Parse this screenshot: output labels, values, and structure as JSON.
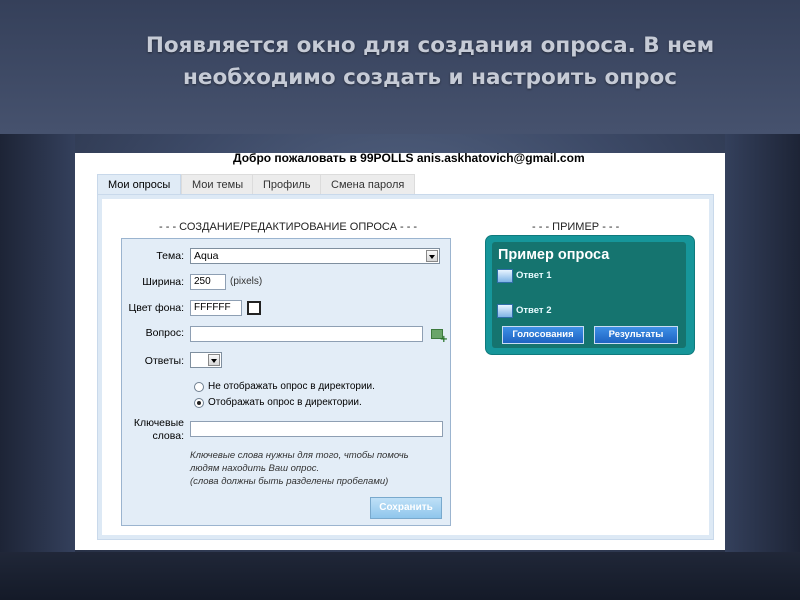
{
  "slide": {
    "title_line1": "Появляется окно для создания опроса. В нем",
    "title_line2": "необходимо создать и настроить опрос"
  },
  "app": {
    "welcome": "Добро пожаловать в 99POLLS anis.askhatovich@gmail.com",
    "tabs": [
      {
        "label": "Мои опросы",
        "active": true
      },
      {
        "label": "Мои темы",
        "active": false
      },
      {
        "label": "Профиль",
        "active": false
      },
      {
        "label": "Смена пароля",
        "active": false
      }
    ]
  },
  "editor": {
    "section_title": "- - - СОЗДАНИЕ/РЕДАКТИРОВАНИЕ ОПРОСА - - -",
    "theme_label": "Тема:",
    "theme_value": "Aqua",
    "width_label": "Ширина:",
    "width_value": "250",
    "width_unit": "(pixels)",
    "bg_label": "Цвет фона:",
    "bg_value": "FFFFFF",
    "question_label": "Вопрос:",
    "question_value": "",
    "answers_label": "Ответы:",
    "answers_value": "",
    "radio_hide": "Не отображать опрос в директории.",
    "radio_show": "Отображать опрос в директории.",
    "keywords_label_1": "Ключевые",
    "keywords_label_2": "слова:",
    "keywords_value": "",
    "hint_1": "Ключевые слова нужны для того, чтобы помочь",
    "hint_2": "людям находить Ваш опрос.",
    "hint_3": "(слова должны быть разделены пробелами)",
    "save_label": "Сохранить"
  },
  "preview": {
    "section_title": "- - - ПРИМЕР - - -",
    "poll_title": "Пример опроса",
    "answer_1": "Ответ 1",
    "answer_2": "Ответ 2",
    "vote_label": "Голосования",
    "results_label": "Результаты"
  },
  "colors": {
    "poll_outer": "#16969a",
    "poll_inner": "#15746f",
    "poll_button": "#1e63c2",
    "save_button": "#8fc6ec",
    "form_bg": "#e3edf7"
  }
}
